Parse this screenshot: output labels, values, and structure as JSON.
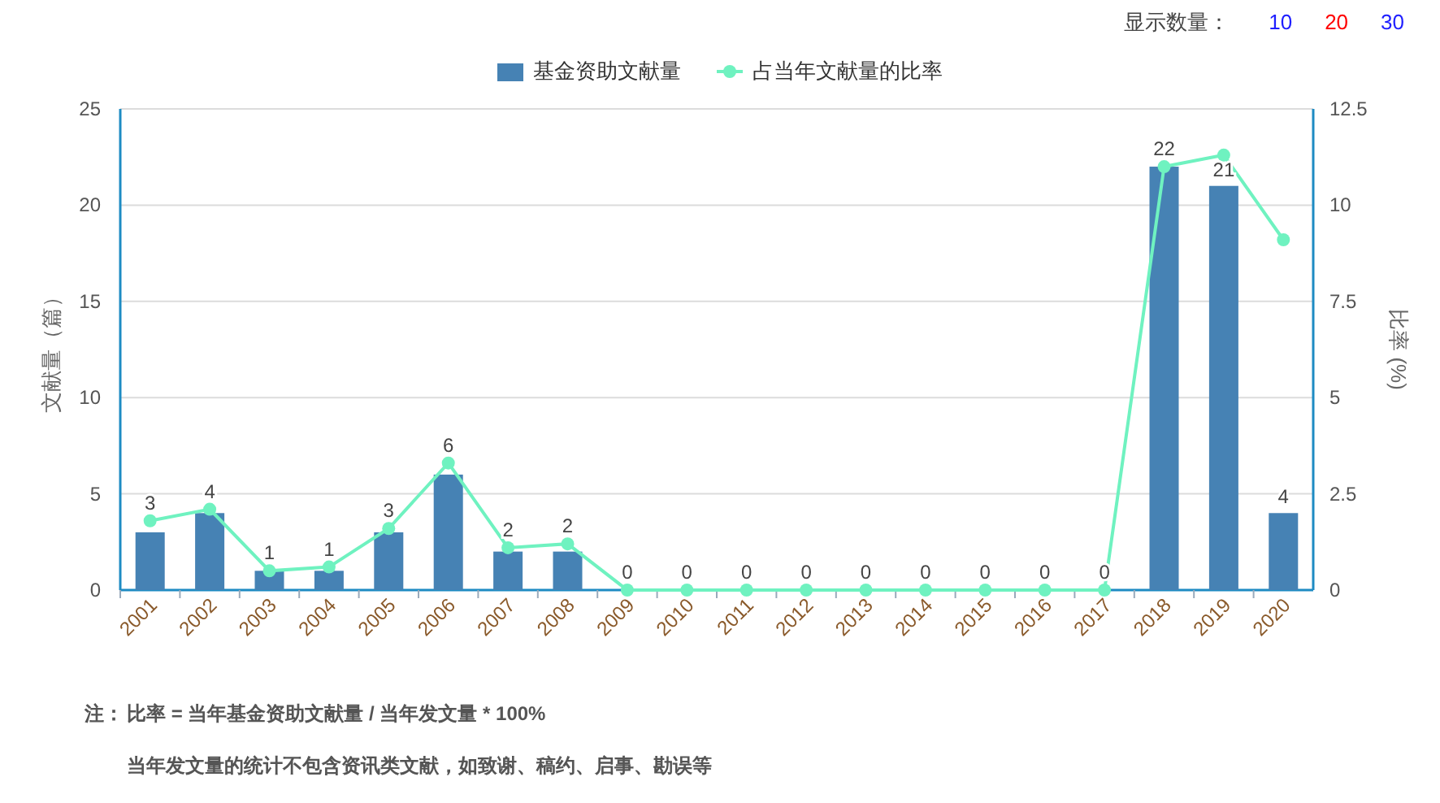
{
  "display_count": {
    "label": "显示数量：",
    "options": [
      {
        "label": "10",
        "selected": false
      },
      {
        "label": "20",
        "selected": true
      },
      {
        "label": "30",
        "selected": false
      }
    ]
  },
  "chart": {
    "chart_data": {
      "type": "bar",
      "categories": [
        "2001",
        "2002",
        "2003",
        "2004",
        "2005",
        "2006",
        "2007",
        "2008",
        "2009",
        "2010",
        "2011",
        "2012",
        "2013",
        "2014",
        "2015",
        "2016",
        "2017",
        "2018",
        "2019",
        "2020"
      ],
      "ylabel": "文献量（篇）",
      "ylim": [
        0,
        25
      ],
      "yticks": [
        0,
        5,
        10,
        15,
        20,
        25
      ],
      "y2label": "比率 (%)",
      "y2lim": [
        0,
        12.5
      ],
      "y2ticks": [
        {
          "value": 0,
          "label": "0"
        },
        {
          "value": 2.5,
          "label": "2.5"
        },
        {
          "value": 5,
          "label": "5"
        },
        {
          "value": 7.5,
          "label": "7.5"
        },
        {
          "value": 10,
          "label": "10"
        },
        {
          "value": 12.5,
          "label": "12.5"
        }
      ],
      "grid": true,
      "series": [
        {
          "name": "基金资助文献量",
          "color": "#4682b4",
          "values": [
            3,
            4,
            1,
            1,
            3,
            6,
            2,
            2,
            0,
            0,
            0,
            0,
            0,
            0,
            0,
            0,
            0,
            22,
            21,
            4
          ],
          "value_labels": [
            "3",
            "4",
            "1",
            "1",
            "3",
            "6",
            "2",
            "2",
            "0",
            "0",
            "0",
            "0",
            "0",
            "0",
            "0",
            "0",
            "0",
            "22",
            "21",
            "4"
          ]
        },
        {
          "name": "占当年文献量的比率",
          "type": "line",
          "axis": "y2",
          "marker": true,
          "color": "#6ff2c0",
          "values": [
            1.8,
            2.1,
            0.5,
            0.6,
            1.6,
            3.3,
            1.1,
            1.2,
            0,
            0,
            0,
            0,
            0,
            0,
            0,
            0,
            0,
            11.0,
            11.3,
            9.1
          ]
        }
      ]
    }
  },
  "notes": [
    "注：",
    "比率 = 当年基金资助文献量 / 当年发文量 * 100%",
    "当年发文量的统计不包含资讯类文献，如致谢、稿约、启事、勘误等"
  ]
}
